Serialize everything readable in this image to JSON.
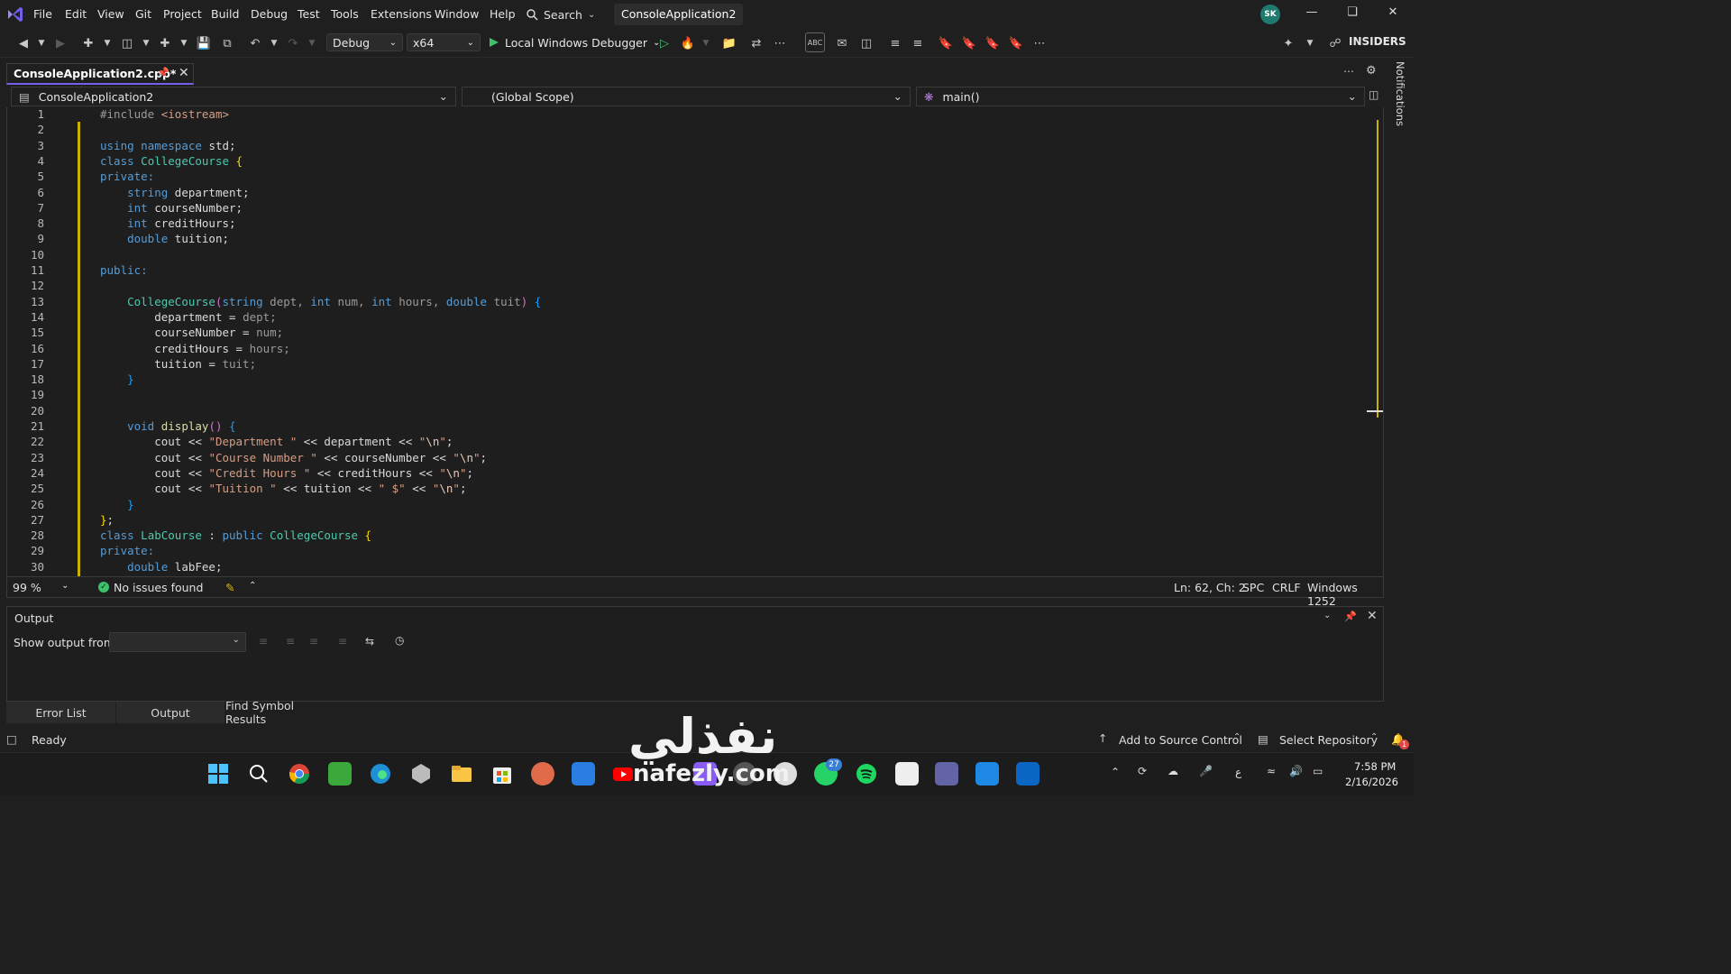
{
  "menu": [
    "File",
    "Edit",
    "View",
    "Git",
    "Project",
    "Build",
    "Debug",
    "Test",
    "Tools",
    "Extensions",
    "Window",
    "Help"
  ],
  "search_label": "Search",
  "solution_name": "ConsoleApplication2",
  "user_initials": "SK",
  "toolbar": {
    "config": "Debug",
    "platform": "x64",
    "debugger": "Local Windows Debugger",
    "insiders": "INSIDERS"
  },
  "editor_tab": {
    "filename": "ConsoleApplication2.cpp*"
  },
  "navbar": {
    "project": "ConsoleApplication2",
    "scope": "(Global Scope)",
    "member": "main()"
  },
  "code_lines": [
    "1",
    "2",
    "3",
    "4",
    "5",
    "6",
    "7",
    "8",
    "9",
    "10",
    "11",
    "12",
    "13",
    "14",
    "15",
    "16",
    "17",
    "18",
    "19",
    "20",
    "21",
    "22",
    "23",
    "24",
    "25",
    "26",
    "27",
    "28",
    "29",
    "30"
  ],
  "editor_status": {
    "zoom": "99 %",
    "issues": "No issues found",
    "position": "Ln: 62, Ch: 2",
    "whitespace": "SPC",
    "line_ending": "CRLF",
    "encoding": "Windows 1252"
  },
  "output": {
    "title": "Output",
    "show_from_label": "Show output from:",
    "show_from_value": ""
  },
  "bottom_tabs": [
    "Error List",
    "Output",
    "Find Symbol Results"
  ],
  "statusbar": {
    "state": "Ready",
    "source_control": "Add to Source Control",
    "repository": "Select Repository",
    "notifications_count": "1"
  },
  "side_panel": "Notifications",
  "taskbar": {
    "time": "7:58 PM",
    "date": "2/16/2026",
    "whatsapp_badge": "27",
    "lang": "ع"
  },
  "watermark": {
    "arabic": "نفذلي",
    "latin": "nafezly.com"
  }
}
